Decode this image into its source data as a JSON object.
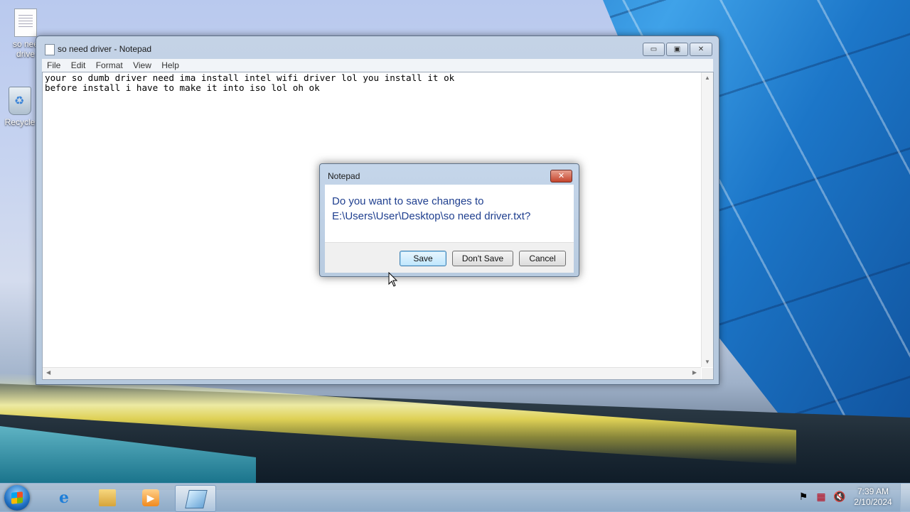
{
  "desktop": {
    "icons": [
      {
        "label": "so nee\ndrive",
        "icon": "text-document-icon"
      },
      {
        "label": "Recycle",
        "icon": "recycle-bin-icon"
      }
    ]
  },
  "notepad": {
    "title": "so need driver - Notepad",
    "menu": [
      "File",
      "Edit",
      "Format",
      "View",
      "Help"
    ],
    "content": "your so dumb driver need ima install intel wifi driver lol you install it ok\nbefore install i have to make it into iso lol oh ok",
    "caption_buttons": {
      "minimize": "▭",
      "maximize": "▣",
      "close": "✕"
    }
  },
  "dialog": {
    "title": "Notepad",
    "message_line1": "Do you want to save changes to",
    "message_line2": "E:\\Users\\User\\Desktop\\so need driver.txt?",
    "buttons": {
      "save": "Save",
      "dont_save": "Don't Save",
      "cancel": "Cancel"
    },
    "close_glyph": "✕"
  },
  "taskbar": {
    "pinned": [
      {
        "name": "internet-explorer",
        "icon": "ie-icon",
        "glyph": "e"
      },
      {
        "name": "windows-explorer",
        "icon": "folder-icon",
        "glyph": ""
      },
      {
        "name": "media-player",
        "icon": "media-player-icon",
        "glyph": "▶"
      },
      {
        "name": "notepad",
        "icon": "notepad-icon",
        "glyph": "",
        "active": true
      }
    ],
    "tray": {
      "flag": "⚑",
      "network": "▦",
      "volume": "🔇"
    },
    "clock": {
      "time": "7:39 AM",
      "date": "2/10/2024"
    }
  }
}
